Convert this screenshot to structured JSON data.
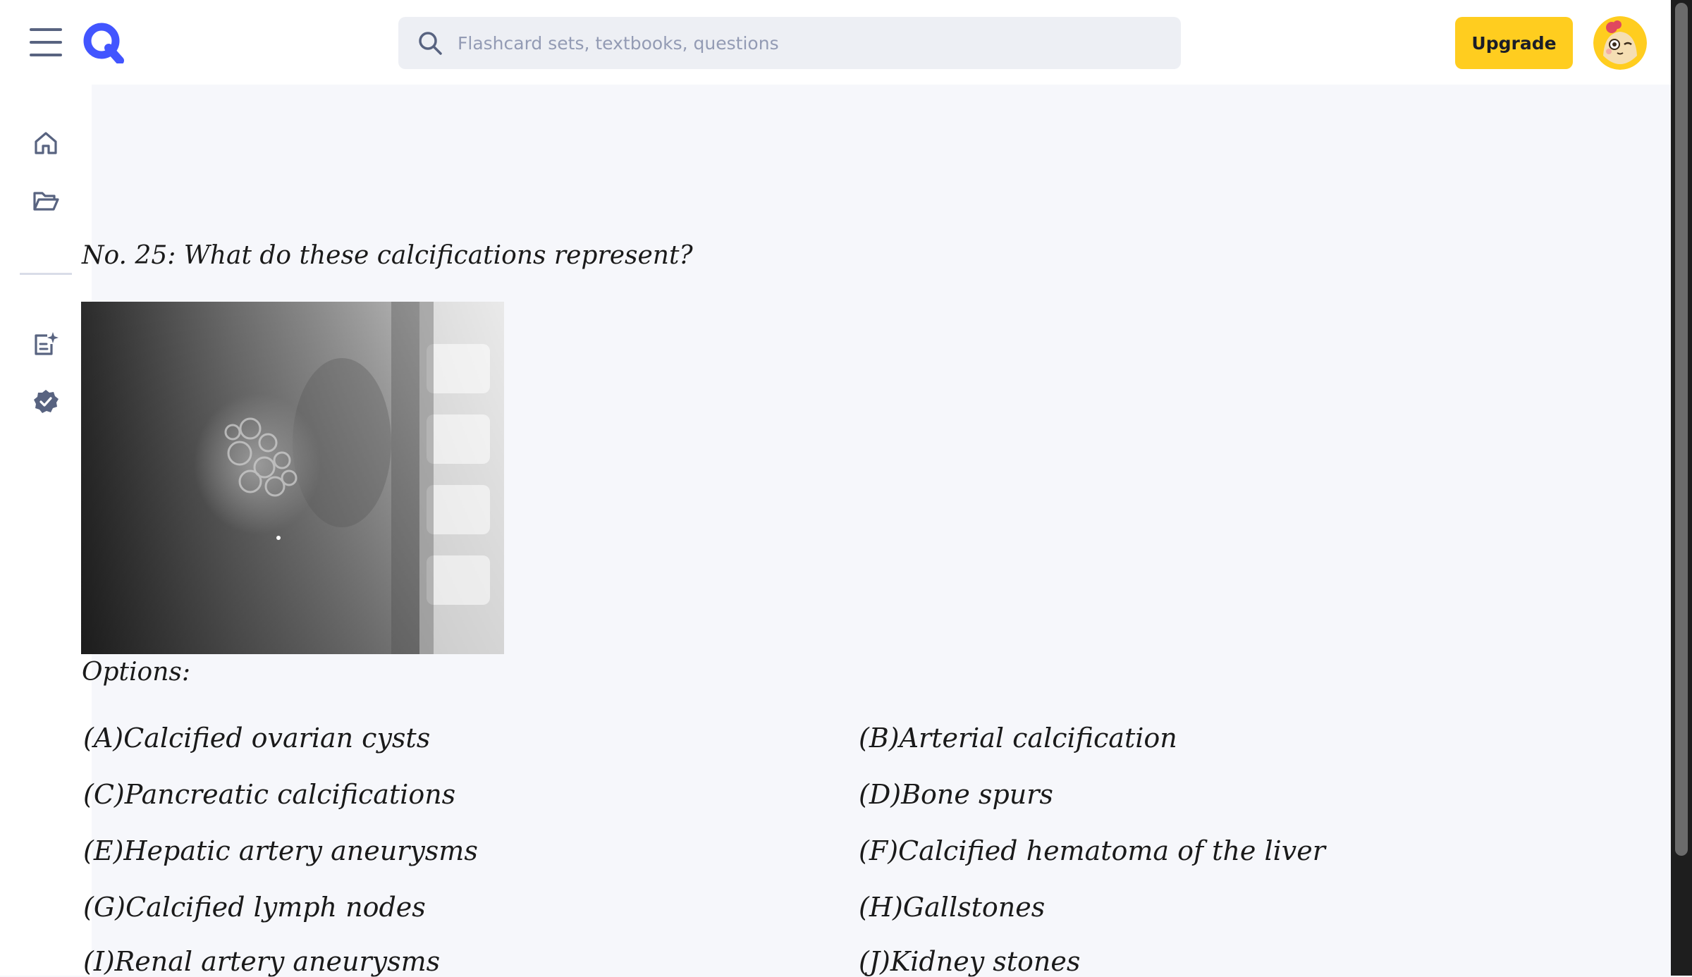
{
  "header": {
    "search_placeholder": "Flashcard sets, textbooks, questions",
    "upgrade_label": "Upgrade",
    "brand_color": "#4255ff",
    "upgrade_color": "#ffcd1f"
  },
  "sidebar": {
    "items": [
      {
        "name": "home",
        "icon": "home-icon"
      },
      {
        "name": "library",
        "icon": "folder-open-icon"
      },
      {
        "name": "create",
        "icon": "note-sparkle-icon"
      },
      {
        "name": "verified",
        "icon": "verified-badge-icon"
      }
    ]
  },
  "main": {
    "question": "No. 25: What do these calcifications represent?",
    "options_label": "Options:",
    "options": [
      {
        "letter": "(A)",
        "text": "Calcified ovarian cysts"
      },
      {
        "letter": "(B)",
        "text": "Arterial calcification"
      },
      {
        "letter": "(C)",
        "text": "Pancreatic calcifications"
      },
      {
        "letter": "(D)",
        "text": "Bone spurs"
      },
      {
        "letter": "(E)",
        "text": "Hepatic artery aneurysms"
      },
      {
        "letter": "(F)",
        "text": "Calcified hematoma of the liver"
      },
      {
        "letter": "(G)",
        "text": "Calcified lymph nodes"
      },
      {
        "letter": "(H)",
        "text": "Gallstones"
      },
      {
        "letter": "(I)",
        "text": "Renal artery aneurysms"
      },
      {
        "letter": "(J)",
        "text": "Kidney stones"
      }
    ]
  }
}
